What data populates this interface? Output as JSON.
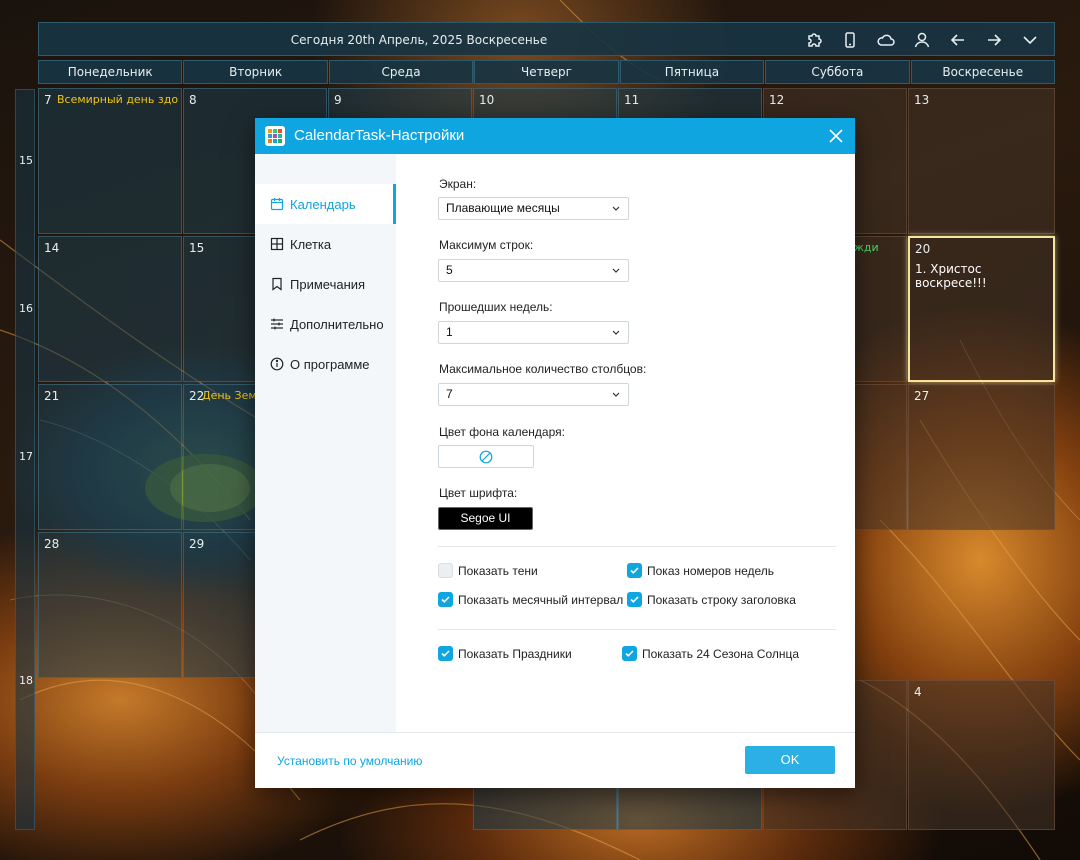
{
  "header": {
    "title": "Сегодня 20th Апрель, 2025 Воскресенье",
    "toolbar_icons": [
      "puzzle-icon",
      "phone-icon",
      "cloud-icon",
      "user-icon",
      "arrow-left-icon",
      "arrow-right-icon",
      "chevron-down-icon"
    ]
  },
  "weekdays": [
    "Понедельник",
    "Вторник",
    "Среда",
    "Четверг",
    "Пятница",
    "Суббота",
    "Воскресенье"
  ],
  "week_numbers": [
    "15",
    "16",
    "17",
    "18"
  ],
  "calendar": {
    "row1": [
      "7",
      "8",
      "9",
      "10",
      "11",
      "12",
      "13"
    ],
    "row2": [
      "14",
      "15",
      "20"
    ],
    "row3": [
      "21",
      "22",
      "27"
    ],
    "row4": [
      "28",
      "29"
    ],
    "row5": [
      "4"
    ],
    "holiday_apr7": "Всемирный день здор",
    "holiday_apr19": "жди",
    "holiday_apr22": "День Зем",
    "task_apr20": "1. Христос воскресе!!!"
  },
  "dialog": {
    "title": "CalendarTask-Настройки",
    "nav": [
      {
        "label": "Календарь",
        "icon": "calendar-icon",
        "active": true
      },
      {
        "label": "Клетка",
        "icon": "grid-icon",
        "active": false
      },
      {
        "label": "Примечания",
        "icon": "bookmark-icon",
        "active": false
      },
      {
        "label": "Дополнительно",
        "icon": "sliders-icon",
        "active": false
      },
      {
        "label": "О программе",
        "icon": "info-icon",
        "active": false
      }
    ],
    "screen_label": "Экран:",
    "screen_value": "Плавающие месяцы",
    "max_rows_label": "Максимум строк:",
    "max_rows_value": "5",
    "past_weeks_label": "Прошедших недель:",
    "past_weeks_value": "1",
    "max_cols_label": "Максимальное количество столбцов:",
    "max_cols_value": "7",
    "bg_color_label": "Цвет фона календаря:",
    "font_color_label": "Цвет шрифта:",
    "font_value": "Segoe UI",
    "checks": {
      "show_shadows": {
        "label": "Показать тени",
        "checked": false
      },
      "show_week_numbers": {
        "label": "Показ номеров недель",
        "checked": true
      },
      "show_month_interval": {
        "label": "Показать месячный интервал",
        "checked": true
      },
      "show_title_bar": {
        "label": "Показать строку заголовка",
        "checked": true
      },
      "show_holidays": {
        "label": "Показать Праздники",
        "checked": true
      },
      "show_solar_terms": {
        "label": "Показать 24 Сезона Солнца",
        "checked": true
      }
    },
    "reset_label": "Установить по умолчанию",
    "ok_label": "OK",
    "colors": {
      "accent": "#0ea5e0",
      "holiday": "#f0c419",
      "holiday_green": "#4cd964"
    }
  }
}
